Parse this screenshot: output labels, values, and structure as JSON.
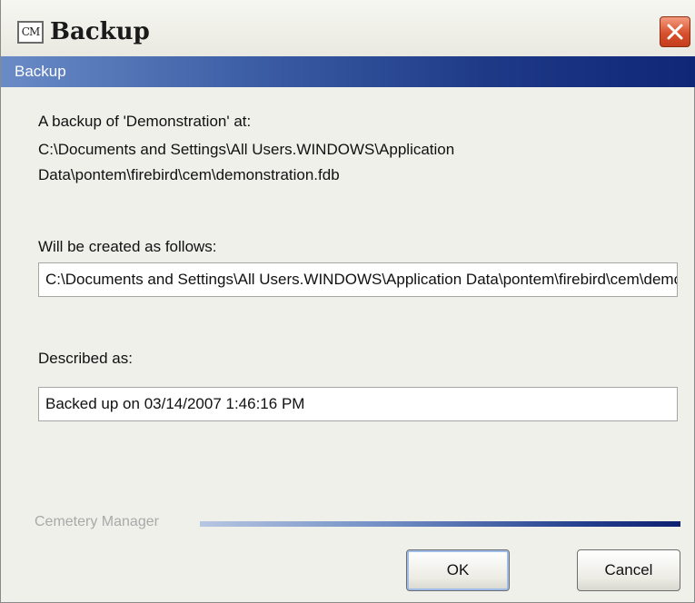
{
  "window": {
    "icon_text": "CM",
    "title": "Backup"
  },
  "header_band": {
    "label": "Backup"
  },
  "content": {
    "intro_line": "A backup of 'Demonstration' at:",
    "source_path_line1": "C:\\Documents and Settings\\All Users.WINDOWS\\Application",
    "source_path_line2": "Data\\pontem\\firebird\\cem\\demonstration.fdb",
    "destination_label": "Will be created as follows:",
    "destination_value": "C:\\Documents and Settings\\All Users.WINDOWS\\Application Data\\pontem\\firebird\\cem\\demonstration.fbk",
    "description_label": "Described as:",
    "description_value": "Backed up on 03/14/2007 1:46:16 PM"
  },
  "footer": {
    "brand": "Cemetery Manager"
  },
  "buttons": {
    "ok": "OK",
    "cancel": "Cancel"
  },
  "colors": {
    "band_start": "#6a8bc6",
    "band_end": "#102677",
    "close_button": "#d8512e"
  },
  "icons": {
    "close": "close-x-icon",
    "app": "cm-app-icon"
  }
}
